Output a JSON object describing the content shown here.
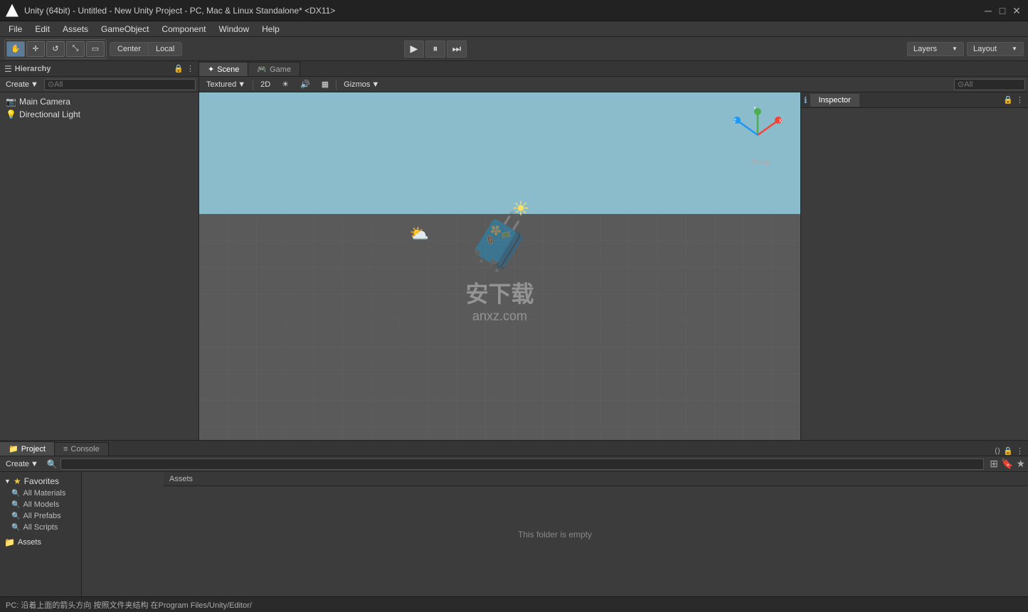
{
  "titlebar": {
    "title": "Unity (64bit) - Untitled - New Unity Project - PC, Mac & Linux Standalone* <DX11>",
    "min": "─",
    "max": "□",
    "close": "✕"
  },
  "menubar": {
    "items": [
      "File",
      "Edit",
      "Assets",
      "GameObject",
      "Component",
      "Window",
      "Help"
    ]
  },
  "toolbar": {
    "tools": [
      "Q",
      "W",
      "E",
      "R",
      "T"
    ],
    "pivot": "Center",
    "space": "Local",
    "play": "▶",
    "pause": "⏸",
    "step": "⏭",
    "layers_label": "Layers",
    "layout_label": "Layout"
  },
  "hierarchy": {
    "title": "Hierarchy",
    "create_label": "Create",
    "search_placeholder": "⊙All",
    "items": [
      {
        "name": "Main Camera",
        "icon": "📷"
      },
      {
        "name": "Directional Light",
        "icon": "💡"
      }
    ]
  },
  "scene": {
    "tabs": [
      {
        "label": "Scene",
        "icon": "✦",
        "active": true
      },
      {
        "label": "Game",
        "icon": "🎮",
        "active": false
      }
    ],
    "toolbar": {
      "textured": "Textured",
      "button_2d": "2D",
      "gizmos": "Gizmos",
      "search_placeholder": "⊙All"
    },
    "persp_label": "←Persp"
  },
  "inspector": {
    "title": "Inspector",
    "icon": "ℹ"
  },
  "project": {
    "tabs": [
      {
        "label": "Project",
        "icon": "📁",
        "active": true
      },
      {
        "label": "Console",
        "icon": "≡",
        "active": false
      }
    ],
    "create_label": "Create",
    "search_placeholder": "",
    "sidebar": {
      "favorites_label": "Favorites",
      "items": [
        "All Materials",
        "All Models",
        "All Prefabs",
        "All Scripts"
      ],
      "assets_label": "Assets"
    },
    "content_area": {
      "empty_message": "This folder is empty"
    }
  },
  "statusbar": {
    "text": "PC: 沿着上面的箭头方向 按照文件夹结构 在Program Files/Unity/Editor/"
  }
}
